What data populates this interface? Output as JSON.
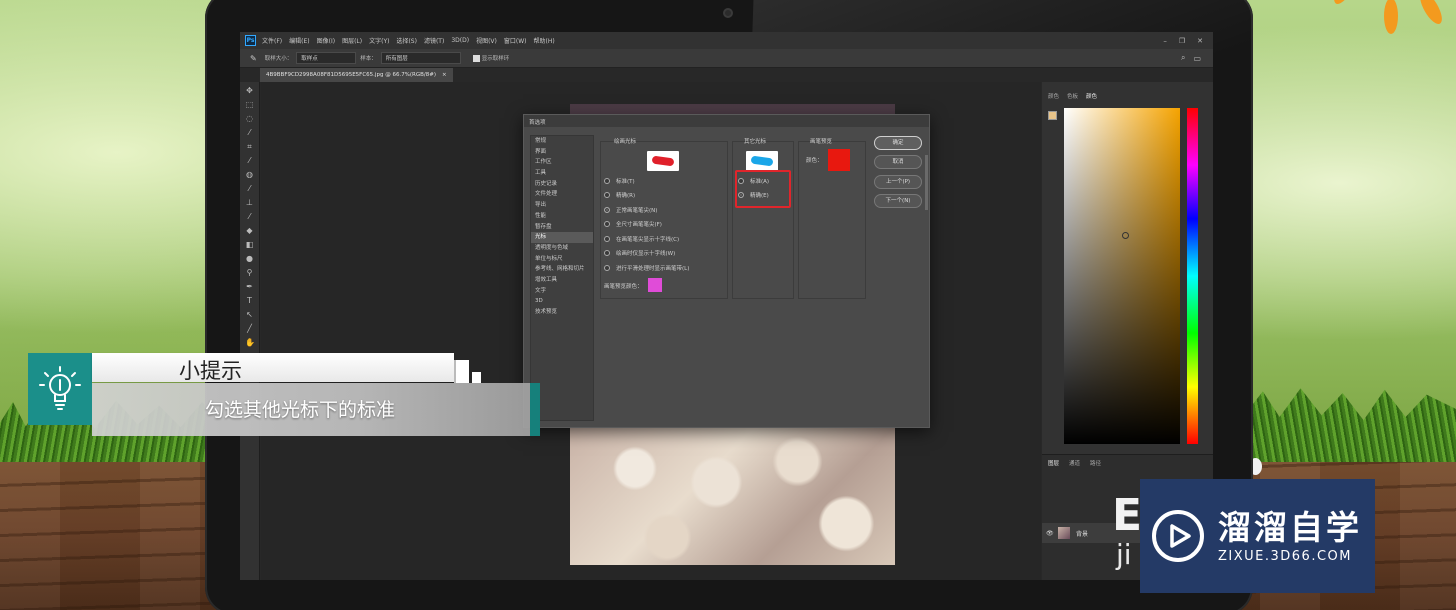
{
  "tip": {
    "title": "小提示",
    "body": "勾选其他光标下的标准"
  },
  "brand": {
    "name": "溜溜自学",
    "url": "ZIXUE.3D66.COM",
    "partial_behind_1": "E",
    "partial_behind_2": "ji"
  },
  "photoshop": {
    "logo": "Ps",
    "menu": [
      "文件(F)",
      "编辑(E)",
      "图像(I)",
      "图层(L)",
      "文字(Y)",
      "选择(S)",
      "滤镜(T)",
      "3D(D)",
      "视图(V)",
      "窗口(W)",
      "帮助(H)"
    ],
    "options": {
      "size_label": "取样大小：",
      "size_value": "取样点",
      "sample_label": "样本：",
      "sample_value": "所有图层",
      "show_ring": "显示取样环"
    },
    "doc_tab": "4B9BBF9CD2998A08F81D5695E5FC65.jpg @ 66.7%(RGB/8#)",
    "right_tabs": [
      "颜色",
      "色板",
      "颜色"
    ],
    "layers_tabs": [
      "图层",
      "通道",
      "路径"
    ],
    "layer_name": "背景"
  },
  "dialog": {
    "title": "首选项",
    "categories": [
      "常规",
      "界面",
      "工作区",
      "工具",
      "历史记录",
      "文件处理",
      "导出",
      "性能",
      "暂存盘",
      "光标",
      "透明度与色域",
      "单位与标尺",
      "参考线、网格和切片",
      "增效工具",
      "文字",
      "3D",
      "技术预览"
    ],
    "selected_category": "光标",
    "painting_cursors": {
      "label": "绘画光标",
      "options": [
        "标准(T)",
        "精确(R)",
        "正常画笔笔尖(N)",
        "全尺寸画笔笔尖(F)",
        "在画笔笔尖显示十字线(C)",
        "绘画时仅显示十字线(W)",
        "进行平滑处理时显示画笔带(L)"
      ],
      "selected": "正常画笔笔尖(N)",
      "brush_color_label": "画笔预览颜色：",
      "brush_color": "#e04cd8"
    },
    "other_cursors": {
      "label": "其它光标",
      "options": [
        "标准(A)",
        "精确(E)"
      ],
      "selected": "精确(E)"
    },
    "brush_preview": {
      "label": "画笔预览",
      "color_label": "颜色：",
      "color": "#e8180f"
    },
    "buttons": [
      "确定",
      "取消",
      "上一个(P)",
      "下一个(N)"
    ]
  },
  "colors": {
    "accent_teal": "#1b8f8a",
    "highlight_red": "#e0252b",
    "brand_blue": "#243a66"
  }
}
